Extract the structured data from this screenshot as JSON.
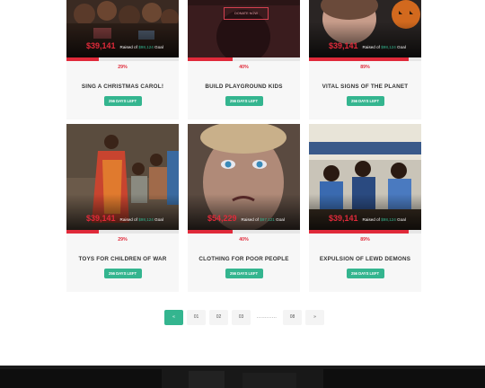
{
  "cards": [
    {
      "amount": "$39,141",
      "raised_label": "Raised of",
      "goal_value": "$98,124",
      "goal_label": "Goal",
      "progress": 0.29,
      "percent": "29%",
      "title": "SING A CHRISTMAS CAROL!",
      "days": "256 DAYS LEFT"
    },
    {
      "amount": "",
      "raised_label": "",
      "goal_value": "",
      "goal_label": "",
      "progress": 0.4,
      "percent": "40%",
      "title": "BUILD PLAYGROUND KIDS",
      "days": "256 DAYS LEFT",
      "donate_label": "DONATE NOW"
    },
    {
      "amount": "$39,141",
      "raised_label": "Raised of",
      "goal_value": "$98,124",
      "goal_label": "Goal",
      "progress": 0.89,
      "percent": "89%",
      "title": "VITAL SIGNS OF THE PLANET",
      "days": "256 DAYS LEFT"
    },
    {
      "amount": "$39,141",
      "raised_label": "Raised of",
      "goal_value": "$98,124",
      "goal_label": "Goal",
      "progress": 0.29,
      "percent": "29%",
      "title": "TOYS FOR CHILDREN OF WAR",
      "days": "256 DAYS LEFT"
    },
    {
      "amount": "$54,229",
      "raised_label": "Raised of",
      "goal_value": "$97,121",
      "goal_label": "Goal",
      "progress": 0.4,
      "percent": "40%",
      "title": "CLOTHING FOR POOR PEOPLE",
      "days": "256 DAYS LEFT"
    },
    {
      "amount": "$39,141",
      "raised_label": "Raised of",
      "goal_value": "$98,124",
      "goal_label": "Goal",
      "progress": 0.89,
      "percent": "89%",
      "title": "EXPULSION OF LEWD DEMONS",
      "days": "256 DAYS LEFT"
    }
  ],
  "pagination": {
    "prev": "«",
    "pages": [
      "01",
      "02",
      "03"
    ],
    "dots": "............",
    "last": "08",
    "next": "»"
  },
  "colors": {
    "accent_red": "#e02a3a",
    "accent_green": "#34b58f"
  }
}
